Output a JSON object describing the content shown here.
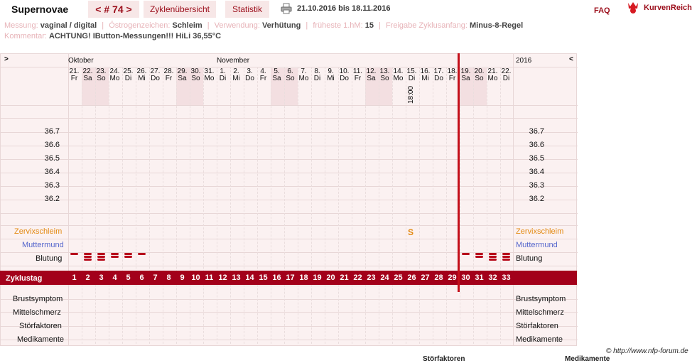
{
  "app": {
    "title": "Supernovae",
    "cycle_nav": "< # 74 >",
    "tabs": [
      "Zyklenübersicht",
      "Statistik"
    ],
    "date_range": "21.10.2016 bis 18.11.2016",
    "faq": "FAQ",
    "brand": "KurvenReich",
    "copyright": "© http://www.nfp-forum.de"
  },
  "info": {
    "messung_k": "Messung:",
    "messung_v": "vaginal / digital",
    "oestrogen_k": "Östrogenzeichen:",
    "oestrogen_v": "Schleim",
    "verwendung_k": "Verwendung:",
    "verwendung_v": "Verhütung",
    "fruehste_k": "früheste 1.hM:",
    "fruehste_v": "15",
    "freigabe_k": "Freigabe Zyklusanfang:",
    "freigabe_v": "Minus-8-Regel",
    "kommentar_k": "Kommentar:",
    "kommentar_v": "ACHTUNG! IButton-Messungen!!! HiLi 36,55°C"
  },
  "chart": {
    "nav_left": ">",
    "nav_right": "<",
    "months": [
      "Oktober",
      "November",
      "2016"
    ],
    "days": [
      {
        "d": "21.",
        "w": "Fr",
        "we": false
      },
      {
        "d": "22.",
        "w": "Sa",
        "we": true
      },
      {
        "d": "23.",
        "w": "So",
        "we": true
      },
      {
        "d": "24.",
        "w": "Mo",
        "we": false
      },
      {
        "d": "25.",
        "w": "Di",
        "we": false
      },
      {
        "d": "26.",
        "w": "Mi",
        "we": false
      },
      {
        "d": "27.",
        "w": "Do",
        "we": false
      },
      {
        "d": "28.",
        "w": "Fr",
        "we": false
      },
      {
        "d": "29.",
        "w": "Sa",
        "we": true
      },
      {
        "d": "30.",
        "w": "So",
        "we": true
      },
      {
        "d": "31.",
        "w": "Mo",
        "we": false
      },
      {
        "d": "1.",
        "w": "Di",
        "we": false
      },
      {
        "d": "2.",
        "w": "Mi",
        "we": false
      },
      {
        "d": "3.",
        "w": "Do",
        "we": false
      },
      {
        "d": "4.",
        "w": "Fr",
        "we": false
      },
      {
        "d": "5.",
        "w": "Sa",
        "we": true
      },
      {
        "d": "6.",
        "w": "So",
        "we": true
      },
      {
        "d": "7.",
        "w": "Mo",
        "we": false
      },
      {
        "d": "8.",
        "w": "Di",
        "we": false
      },
      {
        "d": "9.",
        "w": "Mi",
        "we": false
      },
      {
        "d": "10.",
        "w": "Do",
        "we": false
      },
      {
        "d": "11.",
        "w": "Fr",
        "we": false
      },
      {
        "d": "12.",
        "w": "Sa",
        "we": true
      },
      {
        "d": "13.",
        "w": "So",
        "we": true
      },
      {
        "d": "14.",
        "w": "Mo",
        "we": false
      },
      {
        "d": "15.",
        "w": "Di",
        "we": false
      },
      {
        "d": "16.",
        "w": "Mi",
        "we": false
      },
      {
        "d": "17.",
        "w": "Do",
        "we": false
      },
      {
        "d": "18.",
        "w": "Fr",
        "we": false
      },
      {
        "d": "19.",
        "w": "Sa",
        "we": true
      },
      {
        "d": "20.",
        "w": "So",
        "we": true
      },
      {
        "d": "21.",
        "w": "Mo",
        "we": false
      },
      {
        "d": "22.",
        "w": "Di",
        "we": false
      }
    ],
    "time_label": "18:00",
    "temps": [
      "36.7",
      "36.6",
      "36.5",
      "36.4",
      "36.3",
      "36.2"
    ],
    "row_labels": {
      "zervix": "Zervixschleim",
      "muttermund": "Muttermund",
      "blutung": "Blutung",
      "zyklustag": "Zyklustag",
      "brust": "Brustsymptom",
      "mittel": "Mittelschmerz",
      "stoer": "Störfaktoren",
      "medi": "Medikamente"
    },
    "zervix_mark": "S",
    "bleeding": [
      1,
      3,
      3,
      2,
      2,
      1,
      0,
      0,
      0,
      0,
      0,
      0,
      0,
      0,
      0,
      0,
      0,
      0,
      0,
      0,
      0,
      0,
      0,
      0,
      0,
      0,
      0,
      0,
      0,
      1,
      2,
      3,
      3
    ],
    "cycle_days": [
      "1",
      "2",
      "3",
      "4",
      "5",
      "6",
      "7",
      "8",
      "9",
      "10",
      "11",
      "12",
      "13",
      "14",
      "15",
      "16",
      "17",
      "18",
      "19",
      "20",
      "21",
      "22",
      "23",
      "24",
      "25",
      "26",
      "27",
      "28",
      "29",
      "30",
      "31",
      "32",
      "33"
    ]
  },
  "footer": {
    "stoer": "Störfaktoren",
    "medi": "Medikamente"
  },
  "colors": {
    "accent": "#9b0d1a",
    "cycle_bar": "#a3001a",
    "today_line": "#c40f1a",
    "zervix": "#e38a12",
    "muttermund": "#5566cc"
  }
}
